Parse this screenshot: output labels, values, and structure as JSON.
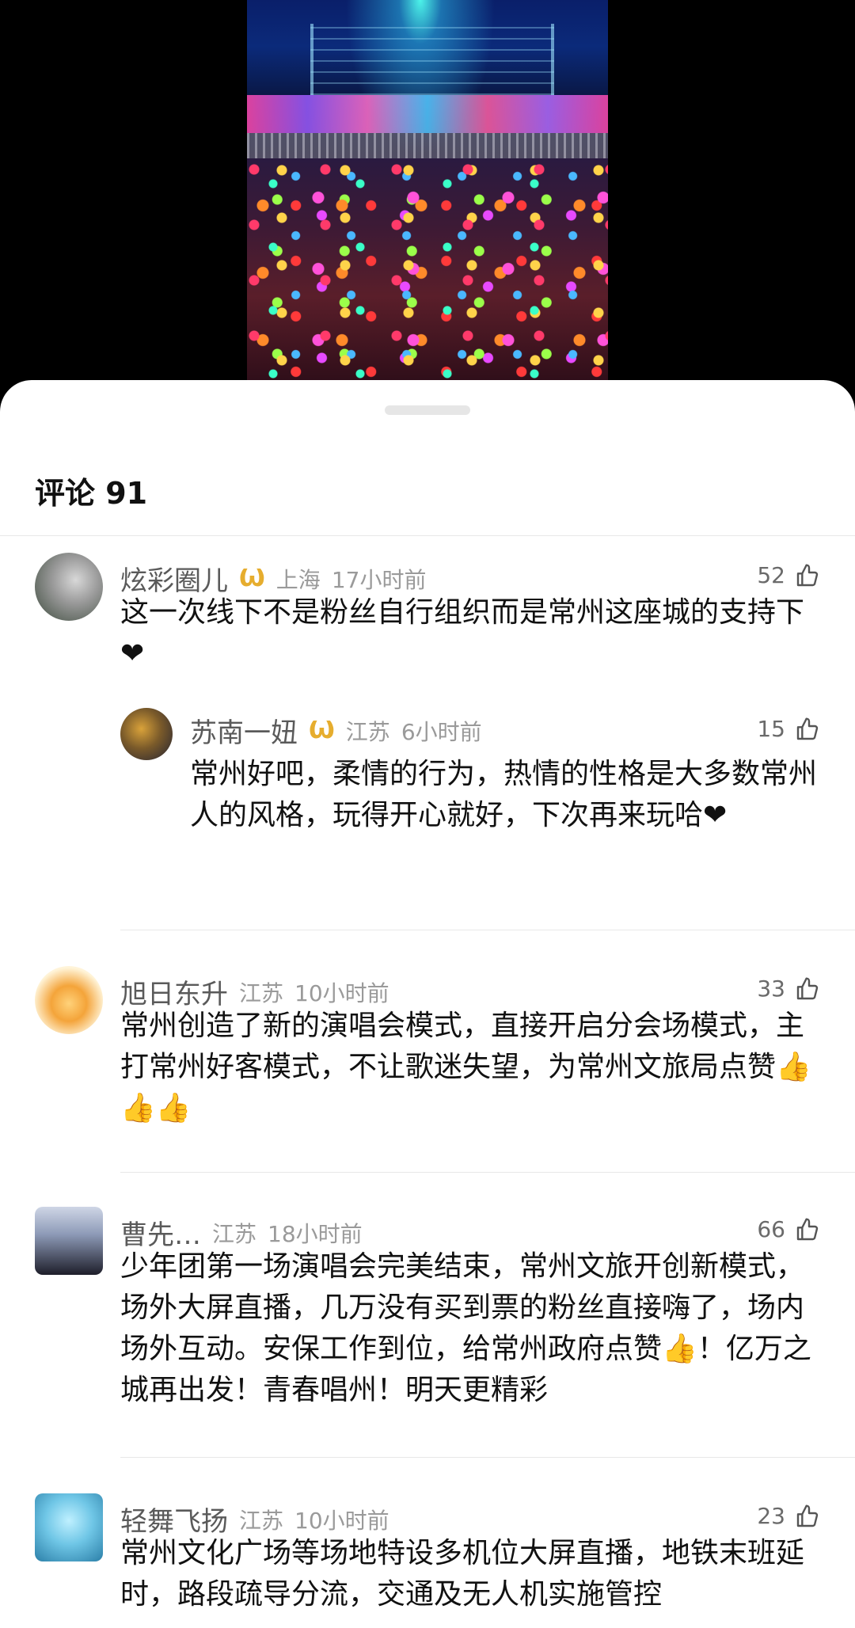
{
  "header": {
    "comments_label": "评论 91"
  },
  "comments": [
    {
      "user": "炫彩圈儿",
      "badge": "Ѡ",
      "location": "上海",
      "time": "17小时前",
      "likes": "52",
      "text": "这一次线下不是粉丝自行组织而是常州这座城的支持下❤",
      "reply": {
        "user": "苏南一妞",
        "badge": "Ѡ",
        "location": "江苏",
        "time": "6小时前",
        "likes": "15",
        "text": "常州好吧，柔情的行为，热情的性格是大多数常州人的风格，玩得开心就好，下次再来玩哈❤"
      }
    },
    {
      "user": "旭日东升",
      "location": "江苏",
      "time": "10小时前",
      "likes": "33",
      "text": "常州创造了新的演唱会模式，直接开启分会场模式，主打常州好客模式，不让歌迷失望，为常州文旅局点赞👍👍👍"
    },
    {
      "user": "曹先…",
      "location": "江苏",
      "time": "18小时前",
      "likes": "66",
      "text": "少年团第一场演唱会完美结束，常州文旅开创新模式，场外大屏直播，几万没有买到票的粉丝直接嗨了，场内场外互动。安保工作到位，给常州政府点赞👍！亿万之城再出发！青春唱州！明天更精彩"
    },
    {
      "user": "轻舞飞扬",
      "location": "江苏",
      "time": "10小时前",
      "likes": "23",
      "text": "常州文化广场等场地特设多机位大屏直播，地铁末班延时，路段疏导分流，交通及无人机实施管控"
    }
  ],
  "colors": {
    "heart": "#ff4a6e",
    "badge": "#e6ad2e",
    "meta": "#9a9a9a"
  }
}
